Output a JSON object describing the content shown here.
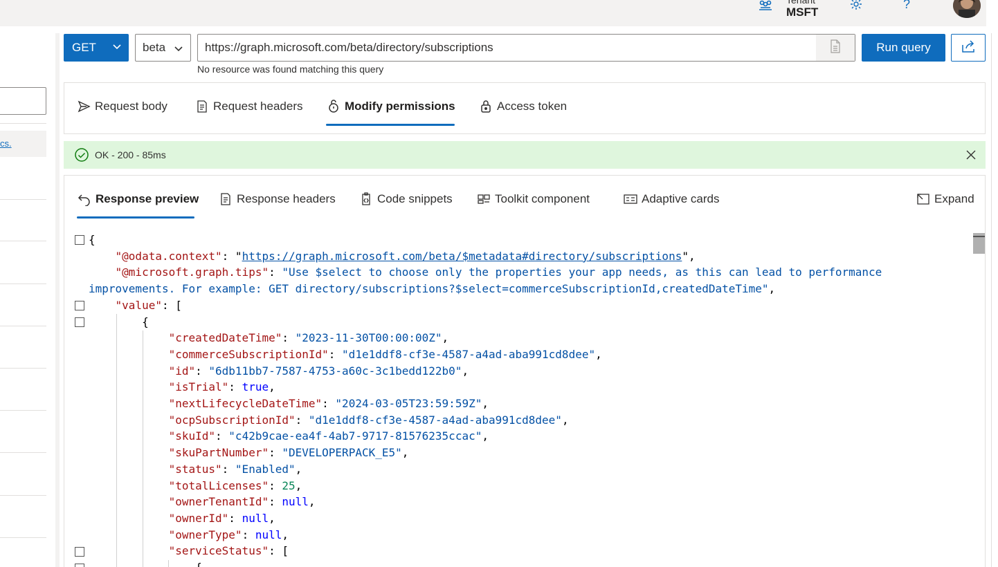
{
  "topbar": {
    "tenant_label": "Tenant",
    "tenant_value": "MSFT",
    "help_glyph": "?"
  },
  "sidebar": {
    "link_text": "cs."
  },
  "query": {
    "method": "GET",
    "version": "beta",
    "url": "https://graph.microsoft.com/beta/directory/subscriptions",
    "hint": "No resource was found matching this query",
    "run_label": "Run query"
  },
  "request_tabs": [
    {
      "label": "Request body",
      "icon": "send-icon",
      "active": false
    },
    {
      "label": "Request headers",
      "icon": "headers-doc-icon",
      "active": false
    },
    {
      "label": "Modify permissions",
      "icon": "permissions-lock-icon",
      "active": true
    },
    {
      "label": "Access token",
      "icon": "access-token-lock-icon",
      "active": false
    }
  ],
  "status": {
    "text": "OK - 200 - 85ms",
    "color": "#dff6dd"
  },
  "response_tabs": [
    {
      "label": "Response preview",
      "icon": "undo-arrow-icon",
      "active": true
    },
    {
      "label": "Response headers",
      "icon": "headers-doc-icon",
      "active": false
    },
    {
      "label": "Code snippets",
      "icon": "code-clipboard-icon",
      "active": false
    },
    {
      "label": "Toolkit component",
      "icon": "toolkit-icon",
      "active": false
    },
    {
      "label": "Adaptive cards",
      "icon": "card-icon",
      "active": false
    }
  ],
  "expand_label": "Expand",
  "response_json": {
    "odata_context_key": "\"@odata.context\"",
    "odata_context_value": "https://graph.microsoft.com/beta/$metadata#directory/subscriptions",
    "tips_key": "\"@microsoft.graph.tips\"",
    "tips_value_line1": "\"Use $select to choose only the properties your app needs, as this can lead to performance",
    "tips_value_line2": "improvements. For example: GET directory/subscriptions?$select=commerceSubscriptionId,createdDateTime\"",
    "value_key": "\"value\"",
    "fields": [
      {
        "key": "\"createdDateTime\"",
        "value": "\"2023-11-30T00:00:00Z\"",
        "type": "string"
      },
      {
        "key": "\"commerceSubscriptionId\"",
        "value": "\"d1e1ddf8-cf3e-4587-a4ad-aba991cd8dee\"",
        "type": "string"
      },
      {
        "key": "\"id\"",
        "value": "\"6db11bb7-7587-4753-a60c-3c1bedd122b0\"",
        "type": "string"
      },
      {
        "key": "\"isTrial\"",
        "value": "true",
        "type": "bool"
      },
      {
        "key": "\"nextLifecycleDateTime\"",
        "value": "\"2024-03-05T23:59:59Z\"",
        "type": "string"
      },
      {
        "key": "\"ocpSubscriptionId\"",
        "value": "\"d1e1ddf8-cf3e-4587-a4ad-aba991cd8dee\"",
        "type": "string"
      },
      {
        "key": "\"skuId\"",
        "value": "\"c42b9cae-ea4f-4ab7-9717-81576235ccac\"",
        "type": "string"
      },
      {
        "key": "\"skuPartNumber\"",
        "value": "\"DEVELOPERPACK_E5\"",
        "type": "string"
      },
      {
        "key": "\"status\"",
        "value": "\"Enabled\"",
        "type": "string"
      },
      {
        "key": "\"totalLicenses\"",
        "value": "25",
        "type": "number"
      },
      {
        "key": "\"ownerTenantId\"",
        "value": "null",
        "type": "bool"
      },
      {
        "key": "\"ownerId\"",
        "value": "null",
        "type": "bool"
      },
      {
        "key": "\"ownerType\"",
        "value": "null",
        "type": "bool"
      }
    ],
    "service_status_key": "\"serviceStatus\""
  }
}
